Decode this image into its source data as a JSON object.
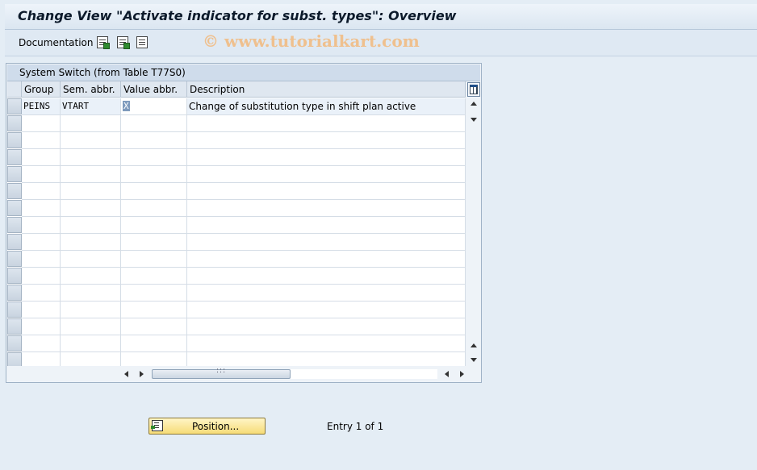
{
  "header": {
    "title": "Change View \"Activate indicator for subst. types\": Overview"
  },
  "toolbar": {
    "documentation_label": "Documentation",
    "watermark": "© www.tutorialkart.com"
  },
  "panel": {
    "title": "System Switch (from Table T77S0)",
    "columns": [
      "Group",
      "Sem. abbr.",
      "Value abbr.",
      "Description"
    ],
    "rows": [
      {
        "group": "PEINS",
        "sem": "VTART",
        "value": "X",
        "desc": "Change of substitution type in shift plan active"
      }
    ]
  },
  "footer": {
    "position_label": "Position...",
    "entry_text": "Entry 1 of 1"
  }
}
